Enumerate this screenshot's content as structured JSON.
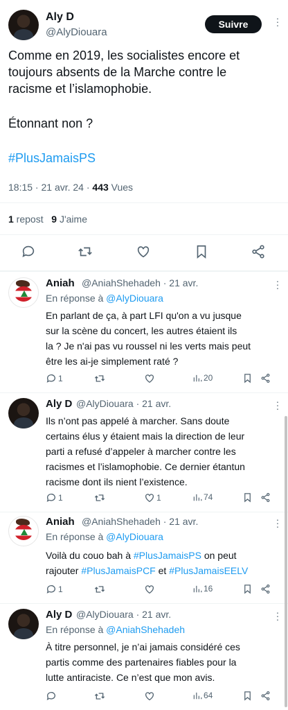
{
  "main_tweet": {
    "author_name": "Aly D",
    "author_handle": "@AlyDiouara",
    "follow_label": "Suivre",
    "line1": "Comme en 2019, les socialistes encore et",
    "line2": "toujours absents de la Marche contre le",
    "line3": "racisme et l’islamophobie.",
    "line4": "Étonnant non ?",
    "hashtag": "#PlusJamaisPS",
    "time": "18:15 · 21 avr. 24 · ",
    "views_count": "443",
    "views_label": " Vues",
    "reposts_count": "1",
    "reposts_label": " repost",
    "likes_count": "9",
    "likes_label": " J'aime"
  },
  "replies": [
    {
      "author_name": "Aniah",
      "author_handle": "@AniahShehadeh · 21 avr.",
      "in_reply_prefix": "En réponse à ",
      "in_reply_handle": "@AlyDiouara",
      "lines": [
        "En parlant de ça, à part LFI qu'on a vu jusque",
        "sur la scène du concert, les autres étaient ils",
        "la ? Je n'ai pas vu roussel ni les verts mais peut",
        "être les ai-je simplement raté ?"
      ],
      "reply_count": "1",
      "like_count": "",
      "view_count": "20"
    },
    {
      "author_name": "Aly D",
      "author_handle": "@AlyDiouara · 21 avr.",
      "lines": [
        "Ils n’ont pas appelé à marcher. Sans doute",
        "certains élus y étaient mais la direction de leur",
        "parti a refusé d’appeler à marcher contre les",
        "racismes et l’islamophobie. Ce dernier étantun",
        "racisme dont ils nient l’existence."
      ],
      "reply_count": "1",
      "like_count": "1",
      "view_count": "74"
    },
    {
      "author_name": "Aniah",
      "author_handle": "@AniahShehadeh · 21 avr.",
      "in_reply_prefix": "En réponse à ",
      "in_reply_handle": "@AlyDiouara",
      "text_a": "Voilà du couo bah à ",
      "tag_a": "#PlusJamaisPS",
      "text_b": " on peut",
      "text_c": "rajouter ",
      "tag_b": "#PlusJamaisPCF",
      "text_d": " et ",
      "tag_c": "#PlusJamaisEELV",
      "reply_count": "1",
      "like_count": "",
      "view_count": "16"
    },
    {
      "author_name": "Aly D",
      "author_handle": "@AlyDiouara · 21 avr.",
      "in_reply_prefix": "En réponse à ",
      "in_reply_handle": "@AniahShehadeh",
      "lines": [
        "À titre personnel, je n’ai jamais considéré ces",
        "partis comme des partenaires fiables pour la",
        "lutte antiraciste. Ce n’est que mon avis."
      ],
      "reply_count": "",
      "like_count": "",
      "view_count": "64"
    }
  ]
}
